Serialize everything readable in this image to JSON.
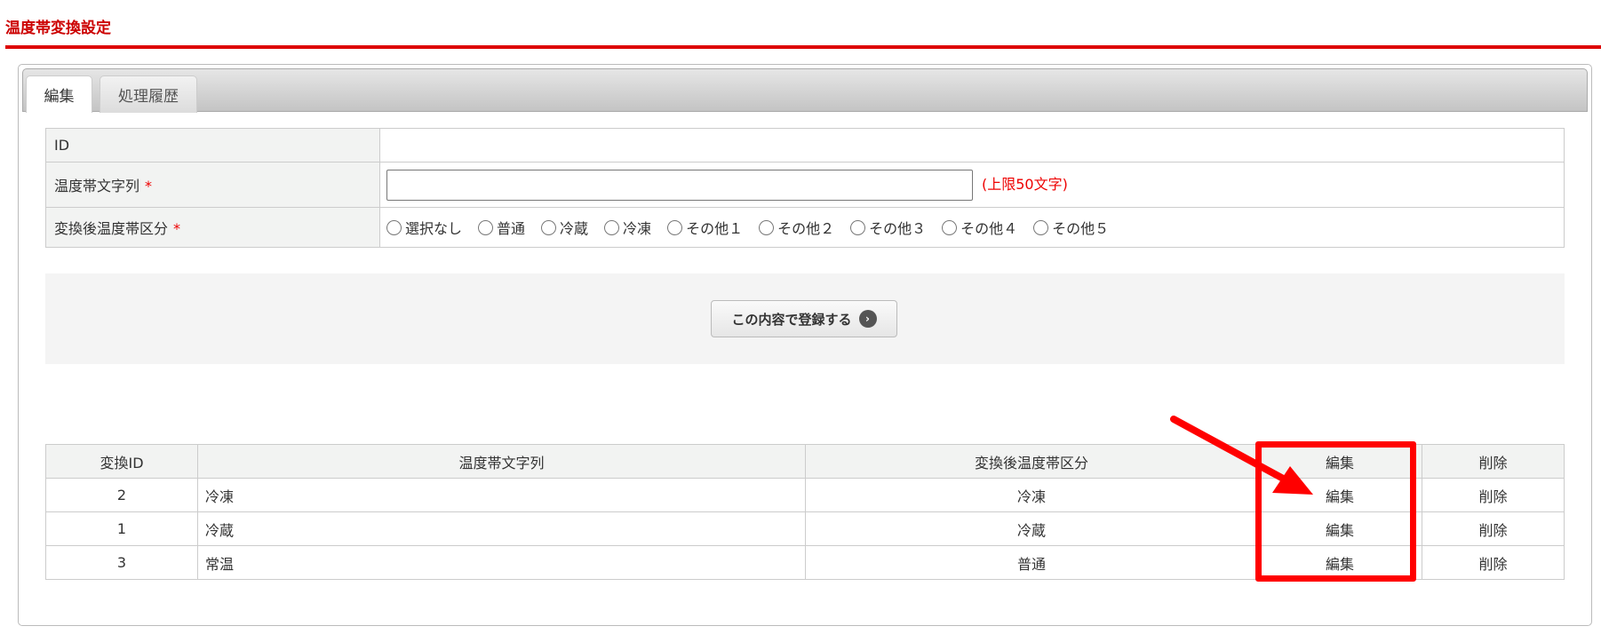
{
  "page_title": "温度帯変換設定",
  "tabs": [
    {
      "label": "編集"
    },
    {
      "label": "処理履歴"
    }
  ],
  "form": {
    "id_label": "ID",
    "id_value": "",
    "name_label": "温度帯文字列",
    "required_mark": "*",
    "name_value": "",
    "name_hint": "(上限50文字)",
    "zone_label": "変換後温度帯区分",
    "zone_options": [
      "選択なし",
      "普通",
      "冷蔵",
      "冷凍",
      "その他１",
      "その他２",
      "その他３",
      "その他４",
      "その他５"
    ]
  },
  "submit_label": "この内容で登録する",
  "submit_icon": "chevron-right-circle-icon",
  "list": {
    "headers": [
      "変換ID",
      "温度帯文字列",
      "変換後温度帯区分",
      "編集",
      "削除"
    ],
    "rows": [
      {
        "id": "2",
        "name": "冷凍",
        "zone": "冷凍",
        "edit": "編集",
        "delete": "削除"
      },
      {
        "id": "1",
        "name": "冷蔵",
        "zone": "冷蔵",
        "edit": "編集",
        "delete": "削除"
      },
      {
        "id": "3",
        "name": "常温",
        "zone": "普通",
        "edit": "編集",
        "delete": "削除"
      }
    ]
  },
  "annotation_color": "#ff0000"
}
